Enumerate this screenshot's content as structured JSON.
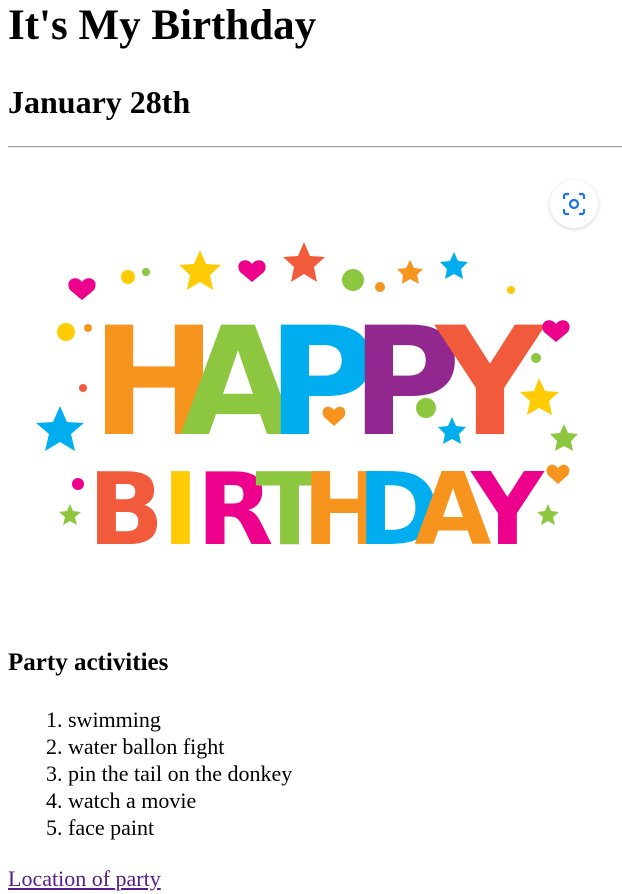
{
  "page": {
    "title": "It's My Birthday",
    "date_heading": "January 28th",
    "image": {
      "line1": [
        "H",
        "A",
        "P",
        "P",
        "Y"
      ],
      "line2": [
        "B",
        "I",
        "R",
        "T",
        "H",
        "D",
        "A",
        "Y"
      ],
      "line1_colors": [
        "#f7941d",
        "#8dc63f",
        "#00aeef",
        "#92278f",
        "#f15a3a"
      ],
      "line2_colors": [
        "#f15a3a",
        "#ffcb05",
        "#ec008c",
        "#8dc63f",
        "#f7941d",
        "#00aeef",
        "#f7941d",
        "#ec008c"
      ],
      "lens_icon": "visual-search-icon"
    },
    "activities_heading": "Party activities",
    "activities": [
      "swimming",
      "water ballon fight",
      "pin the tail on the donkey",
      "watch a movie",
      "face paint"
    ],
    "location_link": "Location of party"
  }
}
